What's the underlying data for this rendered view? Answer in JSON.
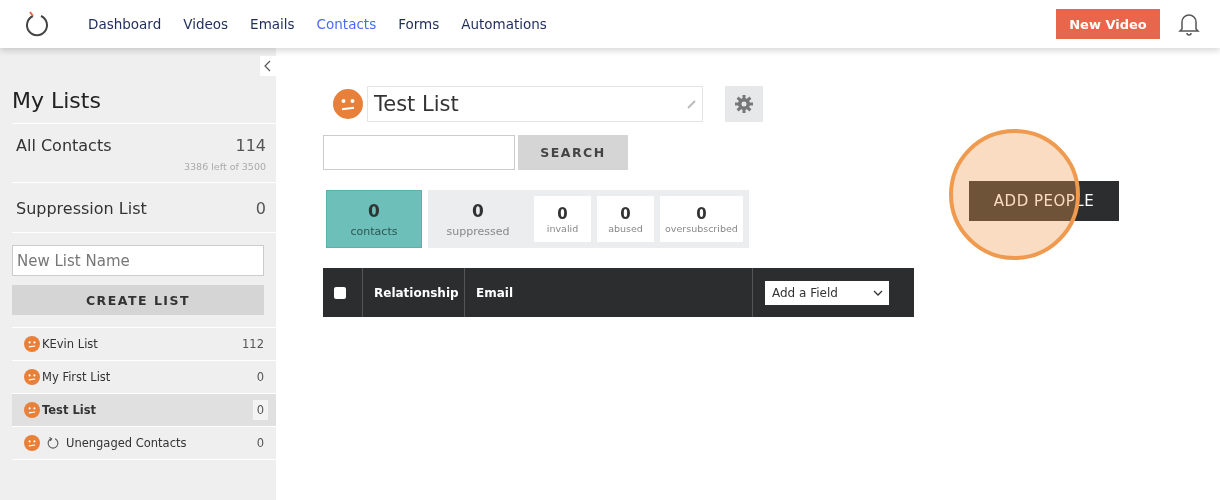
{
  "nav": {
    "items": [
      {
        "label": "Dashboard",
        "selected": false
      },
      {
        "label": "Videos",
        "selected": false
      },
      {
        "label": "Emails",
        "selected": false
      },
      {
        "label": "Contacts",
        "selected": true
      },
      {
        "label": "Forms",
        "selected": false
      },
      {
        "label": "Automations",
        "selected": false
      }
    ],
    "new_video": "New Video"
  },
  "sidebar": {
    "title": "My Lists",
    "all_contacts": {
      "label": "All Contacts",
      "count": "114",
      "quota": "3386 left of 3500"
    },
    "suppression": {
      "label": "Suppression List",
      "count": "0"
    },
    "new_list": {
      "placeholder": "New List Name"
    },
    "create_button": "CREATE LIST",
    "lists": [
      {
        "name": "KEvin List",
        "count": "112",
        "selected": false,
        "auto_refresh": false
      },
      {
        "name": "My First List",
        "count": "0",
        "selected": false,
        "auto_refresh": false
      },
      {
        "name": "Test List",
        "count": "0",
        "selected": true,
        "auto_refresh": false
      },
      {
        "name": "Unengaged Contacts",
        "count": "0",
        "selected": false,
        "auto_refresh": true
      }
    ]
  },
  "main": {
    "list_name": "Test List",
    "search_button": "SEARCH",
    "stats": [
      {
        "value": "0",
        "label": "contacts",
        "selected": true
      },
      {
        "value": "0",
        "label": "suppressed",
        "selected": false
      }
    ],
    "suppressed_breakdown": [
      {
        "value": "0",
        "label": "invalid"
      },
      {
        "value": "0",
        "label": "abused"
      },
      {
        "value": "0",
        "label": "oversubscribed"
      }
    ],
    "table": {
      "select_all": {
        "checked": false
      },
      "columns": [
        "Relationship",
        "Email"
      ],
      "add_field": "Add a Field"
    },
    "add_people": "ADD PEOPLE",
    "highlight": true
  }
}
